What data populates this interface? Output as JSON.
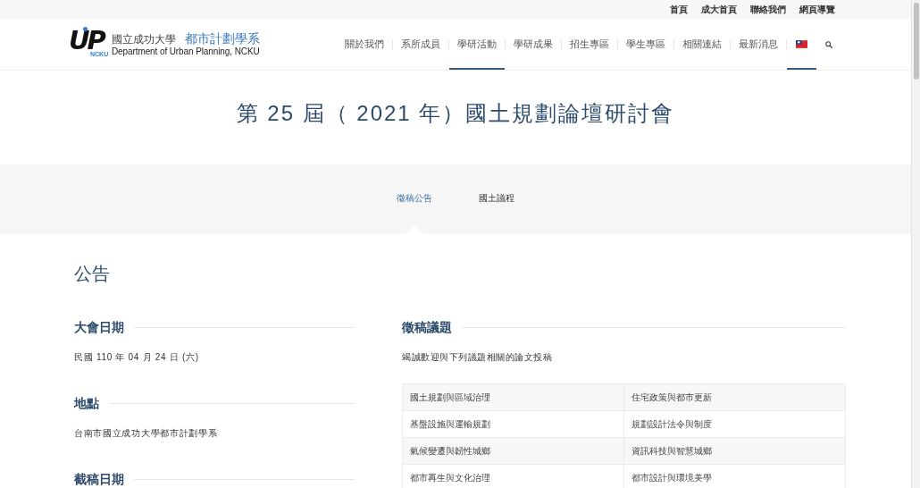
{
  "top_links": [
    "首頁",
    "成大首頁",
    "聯絡我們",
    "網頁導覽"
  ],
  "logo": {
    "mark": "UP",
    "mark_sub": "NCKU",
    "university": "國立成功大學",
    "department": "都市計劃學系",
    "department_en": "Department of Urban Planning, NCKU"
  },
  "nav": {
    "items": [
      {
        "label": "關於我們",
        "selected": false
      },
      {
        "label": "系所成員",
        "selected": false
      },
      {
        "label": "學研活動",
        "selected": true
      },
      {
        "label": "學研成果",
        "selected": false
      },
      {
        "label": "招生專區",
        "selected": false
      },
      {
        "label": "學生專區",
        "selected": false
      },
      {
        "label": "相關連結",
        "selected": false
      },
      {
        "label": "最新消息",
        "selected": false
      }
    ],
    "language": {
      "selected": true
    }
  },
  "page_title": "第 25 屆（ 2021 年）國土規劃論壇研討會",
  "tabs": [
    {
      "label": "徵稿公告",
      "selected": true
    },
    {
      "label": "國土議程",
      "selected": false
    }
  ],
  "announcement": {
    "heading": "公告",
    "details": [
      {
        "heading": "大會日期",
        "text": "民國 110 年 04 月 24 日 (六)"
      },
      {
        "heading": "地點",
        "text": "台南市國立成功大學都市計劃學系"
      },
      {
        "heading": "截稿日期"
      }
    ],
    "topics": {
      "heading": "徵稿議題",
      "intro": "竭誠歡迎與下列議題相關的論文投稿",
      "rows": [
        [
          "國土規劃與區域治理",
          "住宅政策與都市更新"
        ],
        [
          "基盤設施與運輸規劃",
          "規劃設計法令與制度"
        ],
        [
          "氣候變遷與韌性城鄉",
          "資訊科技與智慧城鄉"
        ],
        [
          "都市再生與文化治理",
          "都市設計與環境美學"
        ]
      ]
    }
  }
}
